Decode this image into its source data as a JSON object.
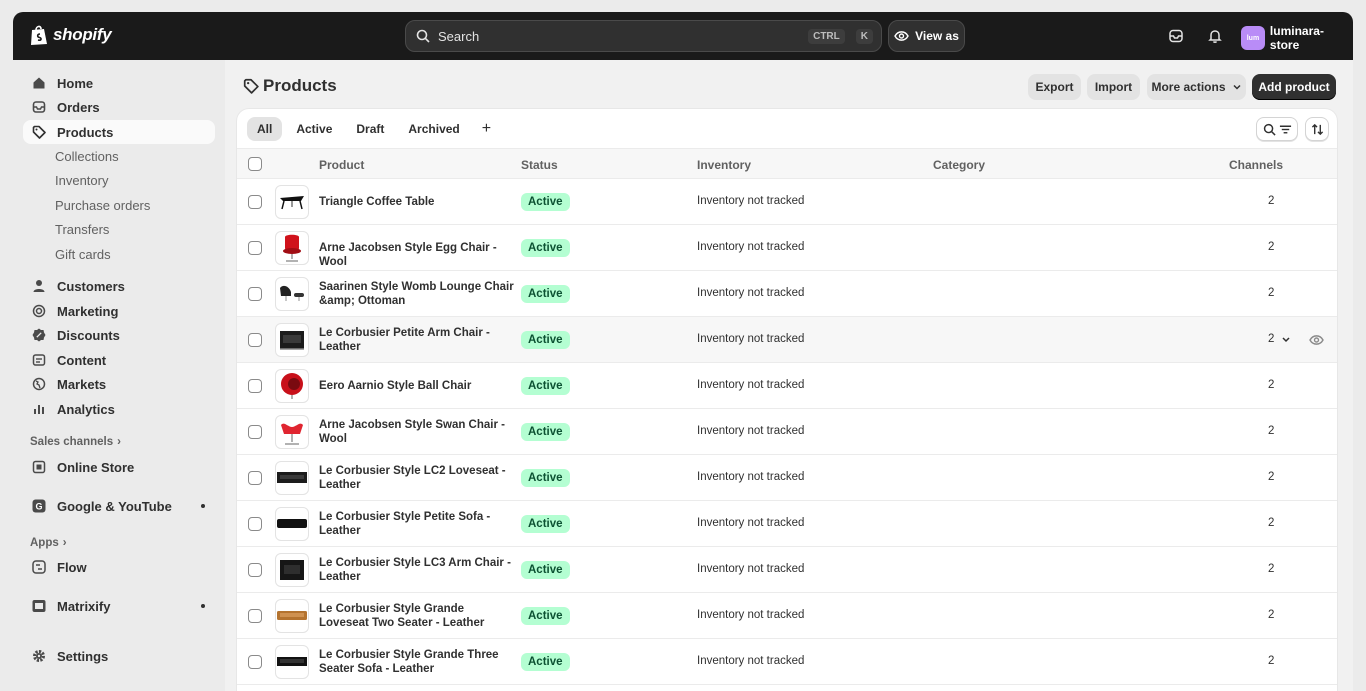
{
  "topbar": {
    "brand": "shopify",
    "search_placeholder": "Search",
    "shortcut_ctrl": "CTRL",
    "shortcut_key": "K",
    "view_as": "View as",
    "store_initials": "lum",
    "store_name": "luminara-store"
  },
  "sidebar": {
    "home": "Home",
    "orders": "Orders",
    "products": "Products",
    "collections": "Collections",
    "inventory": "Inventory",
    "purchase_orders": "Purchase orders",
    "transfers": "Transfers",
    "gift_cards": "Gift cards",
    "customers": "Customers",
    "marketing": "Marketing",
    "discounts": "Discounts",
    "content": "Content",
    "markets": "Markets",
    "analytics": "Analytics",
    "sales_channels": "Sales channels",
    "online_store": "Online Store",
    "google_youtube": "Google & YouTube",
    "apps": "Apps",
    "flow": "Flow",
    "matrixify": "Matrixify",
    "settings": "Settings"
  },
  "page": {
    "title": "Products",
    "export": "Export",
    "import": "Import",
    "more_actions": "More actions",
    "add_product": "Add product"
  },
  "tabs": {
    "all": "All",
    "active": "Active",
    "draft": "Draft",
    "archived": "Archived",
    "add": "+"
  },
  "table": {
    "headers": {
      "product": "Product",
      "status": "Status",
      "inventory": "Inventory",
      "category": "Category",
      "channels": "Channels"
    },
    "rows": [
      {
        "name": "Triangle Coffee Table",
        "status": "Active",
        "inventory": "Inventory not tracked",
        "channels": "2"
      },
      {
        "name": "Arne Jacobsen Style Egg Chair - Wool",
        "status": "Active",
        "inventory": "Inventory not tracked",
        "channels": "2"
      },
      {
        "name": "Saarinen Style Womb Lounge Chair &amp; Ottoman",
        "status": "Active",
        "inventory": "Inventory not tracked",
        "channels": "2"
      },
      {
        "name": "Le Corbusier Petite Arm Chair - Leather",
        "status": "Active",
        "inventory": "Inventory not tracked",
        "channels": "2"
      },
      {
        "name": "Eero Aarnio Style Ball Chair",
        "status": "Active",
        "inventory": "Inventory not tracked",
        "channels": "2"
      },
      {
        "name": "Arne Jacobsen Style Swan Chair - Wool",
        "status": "Active",
        "inventory": "Inventory not tracked",
        "channels": "2"
      },
      {
        "name": "Le Corbusier Style LC2 Loveseat - Leather",
        "status": "Active",
        "inventory": "Inventory not tracked",
        "channels": "2"
      },
      {
        "name": "Le Corbusier Style Petite Sofa - Leather",
        "status": "Active",
        "inventory": "Inventory not tracked",
        "channels": "2"
      },
      {
        "name": "Le Corbusier Style LC3 Arm Chair - Leather",
        "status": "Active",
        "inventory": "Inventory not tracked",
        "channels": "2"
      },
      {
        "name": "Le Corbusier Style Grande Loveseat Two Seater - Leather",
        "status": "Active",
        "inventory": "Inventory not tracked",
        "channels": "2"
      },
      {
        "name": "Le Corbusier Style Grande Three Seater Sofa - Leather",
        "status": "Active",
        "inventory": "Inventory not tracked",
        "channels": "2"
      }
    ]
  },
  "colors": {
    "topbar": "#1a1a1a",
    "badge_bg": "#b4fed2",
    "badge_text": "#0c5132",
    "primary_button": "#303030",
    "avatar": "#b98cf7"
  }
}
